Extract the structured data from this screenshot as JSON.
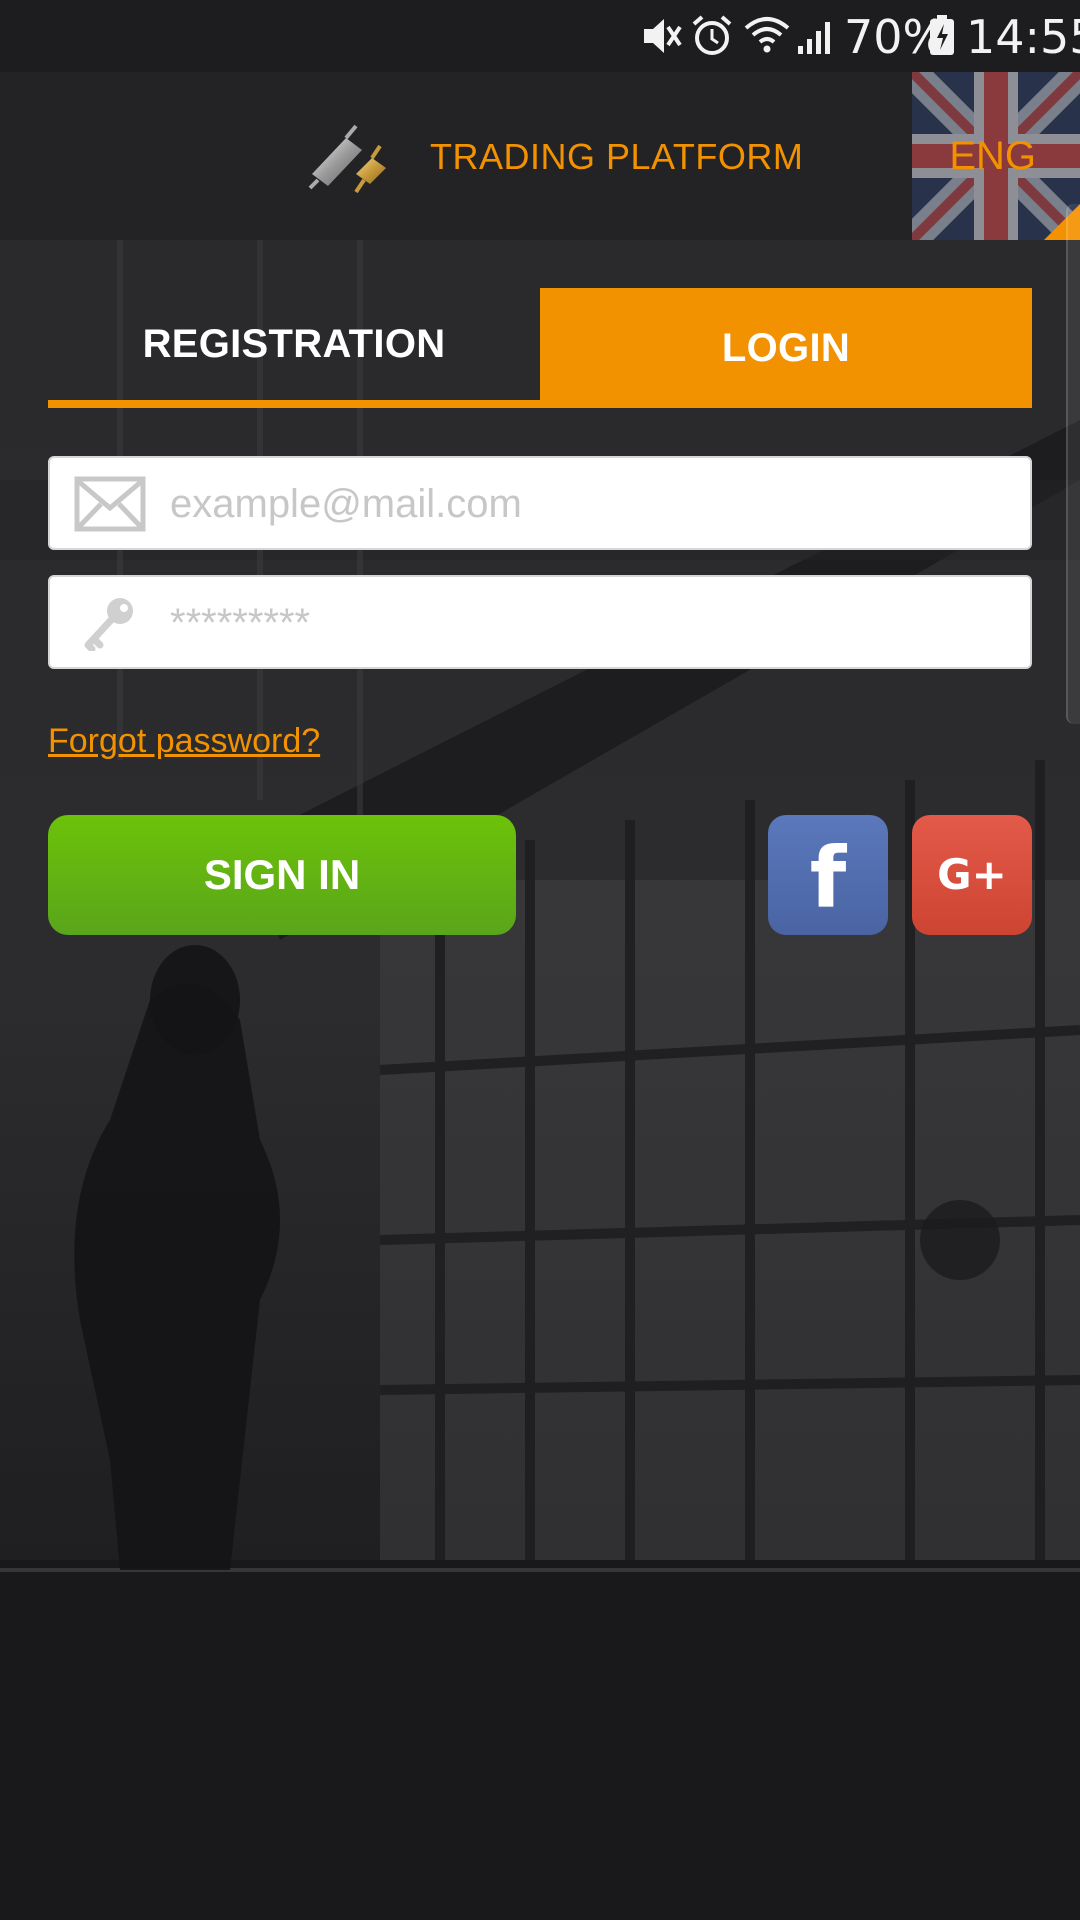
{
  "status_bar": {
    "battery": "70%",
    "time": "14:55",
    "icons": [
      "mute-icon",
      "alarm-icon",
      "wifi-icon",
      "signal-icon",
      "battery-icon"
    ]
  },
  "header": {
    "title": "TRADING PLATFORM",
    "language": "ENG",
    "accent_color": "#f39200"
  },
  "tabs": [
    {
      "label": "REGISTRATION",
      "active": false
    },
    {
      "label": "LOGIN",
      "active": true
    }
  ],
  "form": {
    "email": {
      "value": "",
      "placeholder": "example@mail.com"
    },
    "password": {
      "value": "",
      "placeholder": "*********"
    },
    "forgot_label": "Forgot password?",
    "sign_in_label": "SIGN IN"
  },
  "social": {
    "facebook_glyph": "f",
    "google_glyph": "G+",
    "facebook_color": "#4a64a3",
    "google_color": "#dd4b39"
  },
  "colors": {
    "sign_in": "#62b014",
    "background": "#1f1f21"
  }
}
